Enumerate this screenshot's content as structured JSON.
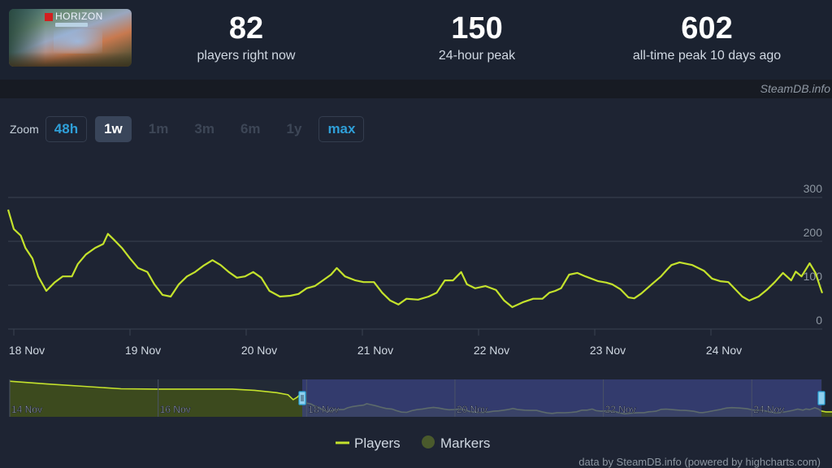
{
  "header": {
    "game_thumbnail": {
      "alt": "LEGO Horizon Adventures",
      "logo_text": "HORIZON"
    },
    "stats": [
      {
        "value": "82",
        "label": "players right now"
      },
      {
        "value": "150",
        "label": "24-hour peak"
      },
      {
        "value": "602",
        "label": "all-time peak 10 days ago"
      }
    ],
    "brand": "SteamDB.info"
  },
  "zoom": {
    "label": "Zoom",
    "buttons": [
      {
        "label": "48h",
        "state": "link"
      },
      {
        "label": "1w",
        "state": "active"
      },
      {
        "label": "1m",
        "state": "disabled"
      },
      {
        "label": "3m",
        "state": "disabled"
      },
      {
        "label": "6m",
        "state": "disabled"
      },
      {
        "label": "1y",
        "state": "disabled"
      },
      {
        "label": "max",
        "state": "link"
      }
    ]
  },
  "colors": {
    "line": "#c4e22c",
    "markers": "#4a5a2c",
    "grid": "#3a4250",
    "navigator_mask": "#3a4280",
    "navigator_fill": "#3c4a1e",
    "handle": "#2aa4d8"
  },
  "chart_data": {
    "type": "line",
    "title": "",
    "xlabel": "",
    "ylabel": "",
    "x_unit": "days since 18 Nov 00:00",
    "xlim": [
      -0.05,
      6.95
    ],
    "ylim": [
      0,
      300
    ],
    "yticks": [
      0,
      100,
      200,
      300
    ],
    "xtick_labels": [
      "18 Nov",
      "19 Nov",
      "20 Nov",
      "21 Nov",
      "22 Nov",
      "23 Nov",
      "24 Nov"
    ],
    "xtick_positions": [
      0,
      1,
      2,
      3,
      4,
      5,
      6
    ],
    "grid": true,
    "legend": {
      "placement": "bottom-center",
      "entries": [
        "Players",
        "Markers"
      ]
    },
    "series": [
      {
        "name": "Players",
        "x": [
          -0.05,
          0.0,
          0.06,
          0.1,
          0.16,
          0.21,
          0.28,
          0.35,
          0.42,
          0.5,
          0.55,
          0.62,
          0.7,
          0.77,
          0.81,
          0.86,
          0.93,
          1.0,
          1.07,
          1.15,
          1.21,
          1.28,
          1.35,
          1.42,
          1.49,
          1.56,
          1.63,
          1.71,
          1.78,
          1.85,
          1.92,
          1.99,
          2.06,
          2.13,
          2.2,
          2.29,
          2.38,
          2.45,
          2.52,
          2.59,
          2.66,
          2.73,
          2.78,
          2.85,
          2.94,
          3.01,
          3.1,
          3.17,
          3.24,
          3.31,
          3.38,
          3.48,
          3.57,
          3.64,
          3.71,
          3.78,
          3.85,
          3.9,
          3.97,
          4.06,
          4.15,
          4.22,
          4.29,
          4.38,
          4.47,
          4.55,
          4.61,
          4.66,
          4.71,
          4.78,
          4.85,
          4.92,
          5.03,
          5.1,
          5.15,
          5.22,
          5.29,
          5.34,
          5.4,
          5.49,
          5.57,
          5.62,
          5.66,
          5.73,
          5.84,
          5.94,
          6.01,
          6.08,
          6.15,
          6.27,
          6.33,
          6.41,
          6.48,
          6.55,
          6.62,
          6.69,
          6.73,
          6.78,
          6.85,
          6.9,
          6.94,
          7.0,
          7.09
        ],
        "values": [
          272,
          228,
          213,
          185,
          161,
          120,
          87,
          106,
          120,
          120,
          148,
          170,
          185,
          194,
          217,
          204,
          185,
          161,
          139,
          130,
          102,
          78,
          74,
          102,
          120,
          130,
          144,
          157,
          146,
          130,
          117,
          120,
          130,
          117,
          87,
          74,
          76,
          80,
          93,
          98,
          111,
          124,
          139,
          120,
          111,
          107,
          107,
          83,
          65,
          56,
          69,
          67,
          74,
          83,
          111,
          111,
          130,
          102,
          93,
          98,
          89,
          65,
          50,
          61,
          69,
          69,
          83,
          87,
          93,
          124,
          128,
          120,
          109,
          106,
          102,
          91,
          72,
          70,
          81,
          102,
          120,
          135,
          146,
          152,
          146,
          133,
          115,
          109,
          107,
          74,
          65,
          74,
          89,
          107,
          128,
          111,
          131,
          120,
          150,
          128,
          96,
          82,
          82
        ]
      }
    ],
    "navigator": {
      "xtick_labels": [
        "14 Nov",
        "16 Nov",
        "18 Nov",
        "20 Nov",
        "22 Nov",
        "24 Nov"
      ],
      "selected_range": [
        "18 Nov",
        "24 Nov"
      ]
    }
  },
  "footer": {
    "legend": [
      {
        "label": "Players",
        "symbol": "line"
      },
      {
        "label": "Markers",
        "symbol": "circle"
      }
    ],
    "credits": "data by SteamDB.info (powered by highcharts.com)"
  }
}
